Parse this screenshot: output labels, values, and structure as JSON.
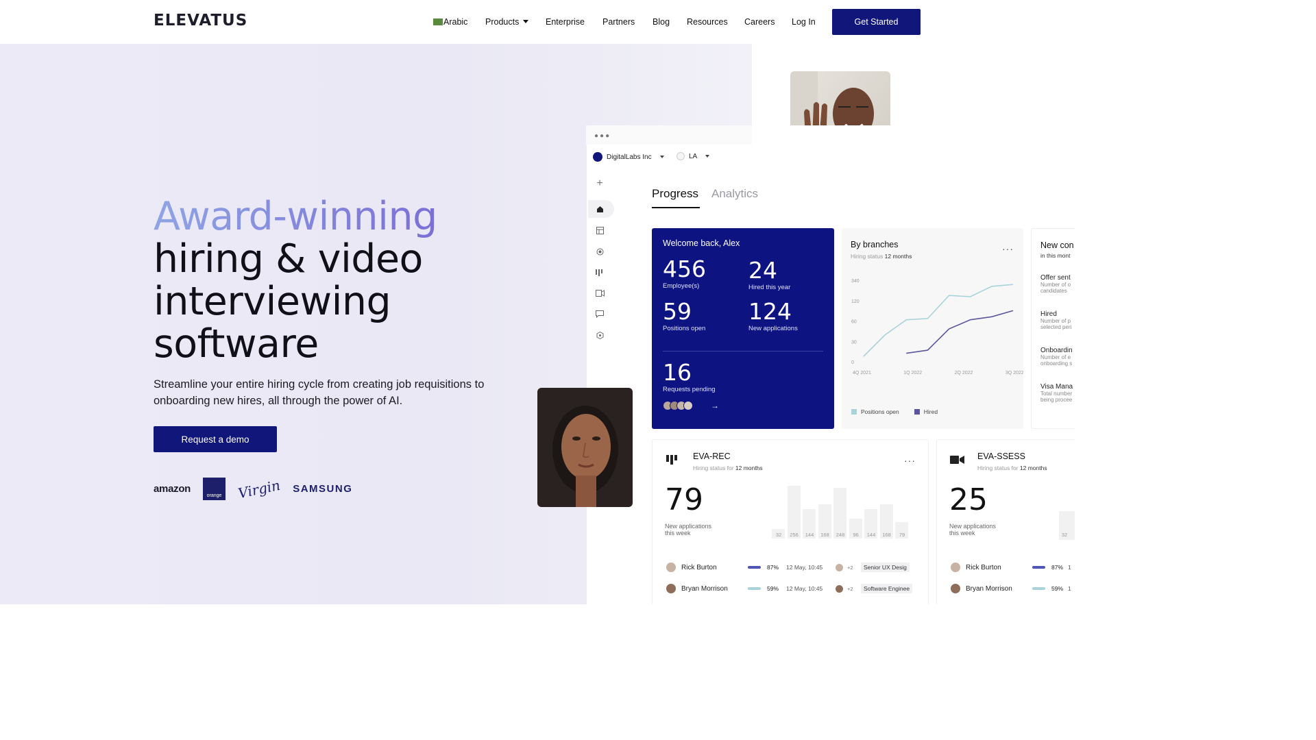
{
  "nav": {
    "logo": "ELEVATUS",
    "items": [
      "Arabic",
      "Products",
      "Enterprise",
      "Partners",
      "Blog",
      "Resources",
      "Careers",
      "Log In"
    ],
    "cta": "Get Started"
  },
  "hero": {
    "headline_accent": "Award-winning",
    "headline_line2": "hiring & video",
    "headline_line3": "interviewing",
    "headline_line4": "software",
    "subtitle": "Streamline your entire hiring cycle from creating job requisitions to onboarding new hires, all through the power of AI.",
    "cta": "Request a demo",
    "client_logos": [
      "amazon",
      "orange",
      "Virgin",
      "SAMSUNG"
    ]
  },
  "dashboard": {
    "org": "DigitalLabs Inc",
    "location": "LA",
    "tabs": [
      "Progress",
      "Analytics"
    ],
    "welcome": {
      "title": "Welcome back, Alex",
      "stats": [
        {
          "value": "456",
          "label": "Employee(s)"
        },
        {
          "value": "24",
          "label": "Hired this year"
        },
        {
          "value": "59",
          "label": "Positions open"
        },
        {
          "value": "124",
          "label": "New applications"
        }
      ],
      "pending_value": "16",
      "pending_label": "Requests pending"
    },
    "branches": {
      "title": "By branches",
      "subtitle_prefix": "Hiring status",
      "subtitle_period": "12 months",
      "legend": [
        "Positions open",
        "Hired"
      ]
    },
    "new_card": {
      "title": "New con",
      "subtitle": "in this mont",
      "items": [
        {
          "title": "Offer sent",
          "desc1": "Number of o",
          "desc2": "candidates"
        },
        {
          "title": "Hired",
          "desc1": "Number of p",
          "desc2": "selected peri"
        },
        {
          "title": "Onboardin",
          "desc1": "Number of e",
          "desc2": "onboarding s"
        },
        {
          "title": "Visa Mana",
          "desc1": "Total number",
          "desc2": "being procee"
        }
      ]
    },
    "eva_rec": {
      "title": "EVA-REC",
      "subtitle_prefix": "Hiring status for",
      "subtitle_period": "12 months",
      "value": "79",
      "label_line1": "New applications",
      "label_line2": "this week",
      "rows": [
        {
          "name": "Rick Burton",
          "pct": "87%",
          "date": "12 May, 10:45",
          "extra": "+2",
          "role": "Senior UX Desig"
        },
        {
          "name": "Bryan Morrison",
          "pct": "59%",
          "date": "12 May, 10:45",
          "extra": "+2",
          "role": "Software Enginee"
        }
      ]
    },
    "eva_sess": {
      "title": "EVA-SSESS",
      "subtitle_prefix": "Hiring status for",
      "subtitle_period": "12 months",
      "value": "25",
      "label_line1": "New applications",
      "label_line2": "this week",
      "bar_label": "32",
      "rows": [
        {
          "name": "Rick Burton",
          "pct": "87%",
          "extra": "1"
        },
        {
          "name": "Bryan Morrison",
          "pct": "59%",
          "extra": "1"
        }
      ]
    }
  },
  "chart_data": [
    {
      "type": "line",
      "title": "By branches",
      "categories": [
        "4Q 2021",
        "1Q 2022",
        "2Q 2022",
        "3Q 2022"
      ],
      "y_ticks": [
        "0",
        "30",
        "60",
        "120",
        "340"
      ],
      "series": [
        {
          "name": "Positions open",
          "color": "#a8d3d8",
          "values": [
            0,
            35,
            60,
            62,
            100,
            98,
            115,
            118
          ]
        },
        {
          "name": "Hired",
          "color": "#5a559e",
          "values": [
            null,
            null,
            5,
            10,
            45,
            60,
            65,
            75
          ]
        }
      ]
    },
    {
      "type": "bar",
      "title": "EVA-REC",
      "values": [
        32,
        256,
        144,
        168,
        248,
        96,
        144,
        168,
        79
      ],
      "labels": [
        "32",
        "256",
        "144",
        "168",
        "248",
        "96",
        "144",
        "168",
        "79"
      ]
    }
  ]
}
